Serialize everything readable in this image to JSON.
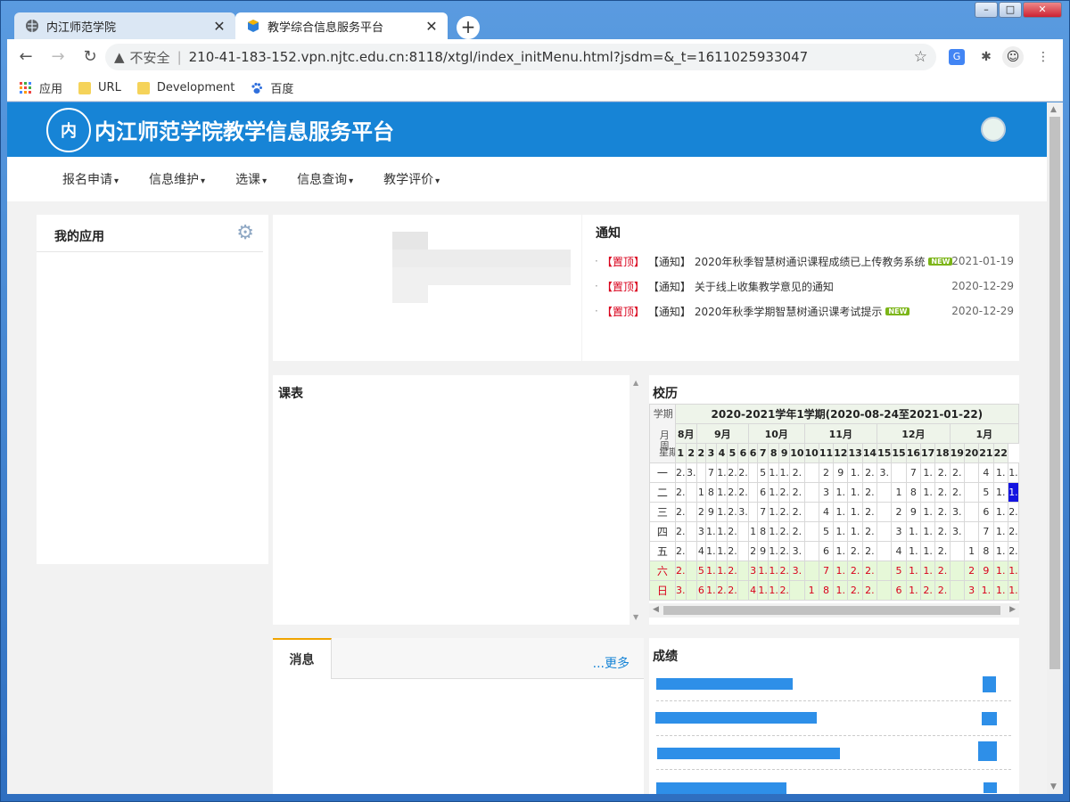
{
  "browser": {
    "tabs": [
      {
        "title": "内江师范学院",
        "active": false
      },
      {
        "title": "教学综合信息服务平台",
        "active": true
      }
    ],
    "security_label": "不安全",
    "url": "210-41-183-152.vpn.njtc.edu.cn:8118/xtgl/index_initMenu.html?jsdm=&_t=1611025933047",
    "bookmarks": [
      "应用",
      "URL",
      "Development",
      "百度"
    ]
  },
  "site": {
    "title": "内江师范学院教学信息服务平台",
    "logo_char": "内",
    "menu": [
      "报名申请",
      "信息维护",
      "选课",
      "信息查询",
      "教学评价"
    ]
  },
  "my_apps": {
    "title": "我的应用"
  },
  "notice": {
    "title": "通知",
    "items": [
      {
        "top": "【置顶】",
        "cat": "【通知】",
        "text": "2020年秋季智慧树通识课程成绩已上传教务系统",
        "new": "NEW",
        "date": "2021-01-19"
      },
      {
        "top": "【置顶】",
        "cat": "【通知】",
        "text": "关于线上收集教学意见的通知",
        "new": "",
        "date": "2020-12-29"
      },
      {
        "top": "【置顶】",
        "cat": "【通知】",
        "text": "2020年秋季学期智慧树通识课考试提示",
        "new": "NEW",
        "date": "2020-12-29"
      }
    ]
  },
  "timetable": {
    "title": "课表"
  },
  "calendar": {
    "title": "校历",
    "term": "2020-2021学年1学期(2020-08-24至2021-01-22)",
    "corner_labels": {
      "term": "学期",
      "month": "月",
      "week": "周",
      "day": "星期"
    },
    "months": [
      "8月",
      "9月",
      "10月",
      "11月",
      "12月",
      "1月"
    ],
    "weeks": [
      "1",
      "2",
      "2",
      "3",
      "4",
      "5",
      "6",
      "6",
      "7",
      "8",
      "9",
      "10",
      "10",
      "11",
      "12",
      "13",
      "14",
      "15",
      "15",
      "16",
      "17",
      "18",
      "19",
      "20",
      "21",
      "22"
    ],
    "weekdays": [
      "一",
      "二",
      "三",
      "四",
      "五",
      "六",
      "日"
    ],
    "rows": [
      [
        "2.",
        "3.",
        "",
        "7",
        "1.",
        "2.",
        "2.",
        "",
        "5",
        "1.",
        "1.",
        "2.",
        "",
        "2",
        "9",
        "1.",
        "2.",
        "3.",
        "",
        "7",
        "1.",
        "2.",
        "2.",
        "",
        "4",
        "1.",
        "1."
      ],
      [
        "2.",
        "",
        "1",
        "8",
        "1.",
        "2.",
        "2.",
        "",
        "6",
        "1.",
        "2.",
        "2.",
        "",
        "3",
        "1.",
        "1.",
        "2.",
        "",
        "1",
        "8",
        "1.",
        "2.",
        "2.",
        "",
        "5",
        "1.",
        "1."
      ],
      [
        "2.",
        "",
        "2",
        "9",
        "1.",
        "2.",
        "3.",
        "",
        "7",
        "1.",
        "2.",
        "2.",
        "",
        "4",
        "1.",
        "1.",
        "2.",
        "",
        "2",
        "9",
        "1.",
        "2.",
        "3.",
        "",
        "6",
        "1.",
        "2."
      ],
      [
        "2.",
        "",
        "3",
        "1.",
        "1.",
        "2.",
        "",
        "1",
        "8",
        "1.",
        "2.",
        "2.",
        "",
        "5",
        "1.",
        "1.",
        "2.",
        "",
        "3",
        "1.",
        "1.",
        "2.",
        "3.",
        "",
        "7",
        "1.",
        "2."
      ],
      [
        "2.",
        "",
        "4",
        "1.",
        "1.",
        "2.",
        "",
        "2",
        "9",
        "1.",
        "2.",
        "3.",
        "",
        "6",
        "1.",
        "2.",
        "2.",
        "",
        "4",
        "1.",
        "1.",
        "2.",
        "",
        "1",
        "8",
        "1.",
        "2."
      ],
      [
        "2.",
        "",
        "5",
        "1.",
        "1.",
        "2.",
        "",
        "3",
        "1.",
        "1.",
        "2.",
        "3.",
        "",
        "7",
        "1.",
        "2.",
        "2.",
        "",
        "5",
        "1.",
        "1.",
        "2.",
        "",
        "2",
        "9",
        "1.",
        "1."
      ],
      [
        "3.",
        "",
        "6",
        "1.",
        "2.",
        "2.",
        "",
        "4",
        "1.",
        "1.",
        "2.",
        "",
        "1",
        "8",
        "1.",
        "2.",
        "2.",
        "",
        "6",
        "1.",
        "2.",
        "2.",
        "",
        "3",
        "1.",
        "1.",
        "1."
      ]
    ],
    "today_cell": "1."
  },
  "messages": {
    "tab": "消息",
    "more": "...更多"
  },
  "grades": {
    "title": "成绩"
  },
  "colors": {
    "header": "#1784d6",
    "notice_top": "#d9001b",
    "new_badge": "#7cb518",
    "weekend": "#e6f8d8"
  }
}
